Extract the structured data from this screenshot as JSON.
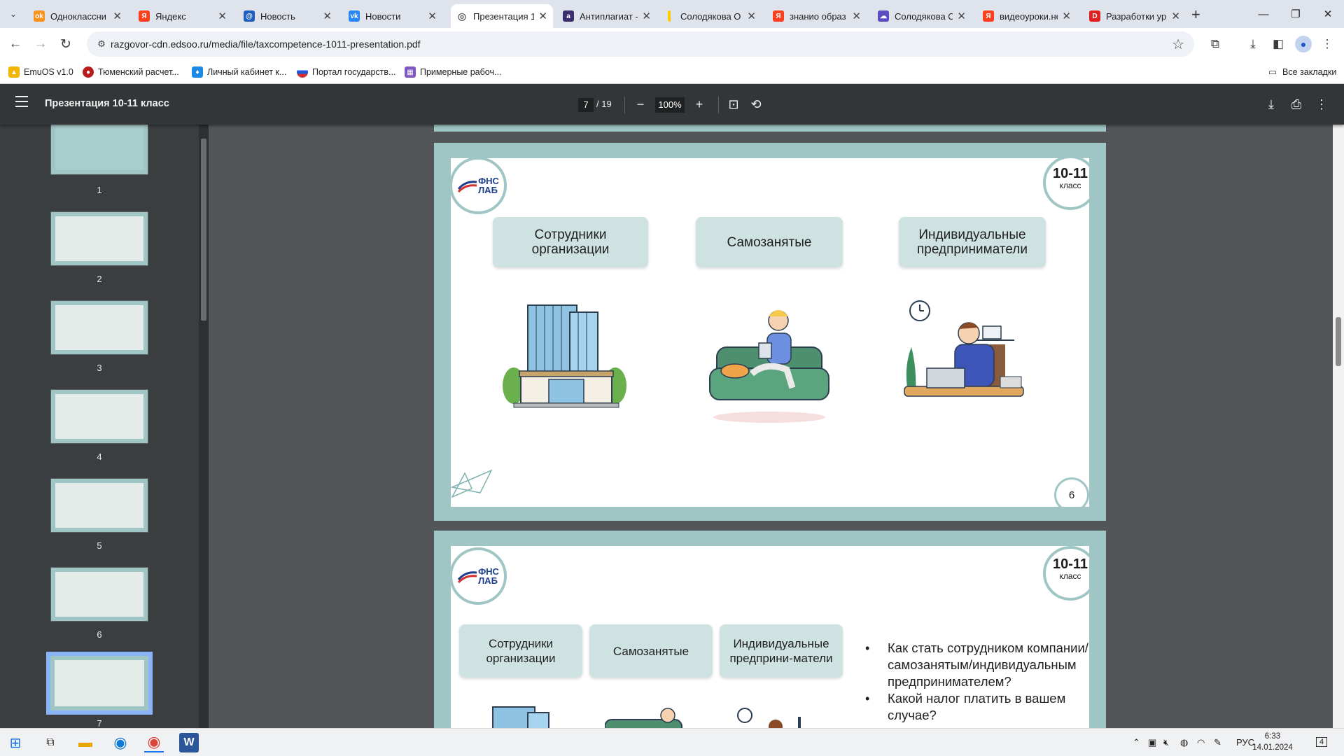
{
  "tabs": [
    {
      "title": "Одноклассни",
      "favicon": "odnoklassniki-icon",
      "color": "#f7931e",
      "glyph": "ok",
      "active": false
    },
    {
      "title": "Яндекс",
      "favicon": "yandex-icon",
      "color": "#fc3f1d",
      "glyph": "Я",
      "active": false
    },
    {
      "title": "Новость",
      "favicon": "news-icon",
      "color": "#1f5fbf",
      "glyph": "@",
      "active": false
    },
    {
      "title": "Новости",
      "favicon": "vk-icon",
      "color": "#2787f5",
      "glyph": "vk",
      "active": false
    },
    {
      "title": "Презентация 1",
      "favicon": "globe-icon",
      "color": "#5f6368",
      "glyph": "◎",
      "active": true
    },
    {
      "title": "Антиплагиат -",
      "favicon": "antiplagiat-icon",
      "color": "#3a2e6e",
      "glyph": "a",
      "active": false
    },
    {
      "title": "Солодякова О",
      "favicon": "yandex-disk-icon",
      "color": "#ffcc00",
      "glyph": "",
      "active": false
    },
    {
      "title": "знанио образ",
      "favicon": "yandex-icon",
      "color": "#fc3f1d",
      "glyph": "Я",
      "active": false
    },
    {
      "title": "Солодякова О",
      "favicon": "cloud-icon",
      "color": "#5b4cc4",
      "glyph": "☁",
      "active": false
    },
    {
      "title": "видеоуроки.не",
      "favicon": "yandex-icon",
      "color": "#fc3f1d",
      "glyph": "Я",
      "active": false
    },
    {
      "title": "Разработки ур",
      "favicon": "razrabotki-icon",
      "color": "#e02020",
      "glyph": "D",
      "active": false
    }
  ],
  "address": {
    "url": "razgovor-cdn.edsoo.ru/media/file/taxcompetence-1011-presentation.pdf"
  },
  "bookmarks": {
    "items": [
      {
        "label": "EmuOS v1.0",
        "color": "#f5b400",
        "icon": "emuos-icon"
      },
      {
        "label": "Тюменский расчет...",
        "color": "#b71c1c",
        "icon": "tyumen-icon"
      },
      {
        "label": "Личный кабинет к...",
        "color": "#1e88e5",
        "icon": "cabinet-icon"
      },
      {
        "label": "Портал государств...",
        "color": "#d32f2f",
        "icon": "gosuslugi-icon"
      },
      {
        "label": "Примерные рабоч...",
        "color": "#7e57c2",
        "icon": "programs-icon"
      }
    ],
    "all_label": "Все закладки"
  },
  "pdf": {
    "title": "Презентация 10-11 класс",
    "current_page": "7",
    "total_pages": "/ 19",
    "zoom": "100%"
  },
  "thumbnails": [
    "1",
    "2",
    "3",
    "4",
    "5",
    "6",
    "7"
  ],
  "slide6": {
    "logo": {
      "line1": "ФНС",
      "line2": "ЛАБ"
    },
    "grade": {
      "number": "10-11",
      "word": "класс"
    },
    "categories": [
      "Сотрудники организации",
      "Самозанятые",
      "Индивидуальные предприниматели"
    ],
    "page_number": "6"
  },
  "slide7": {
    "logo": {
      "line1": "ФНС",
      "line2": "ЛАБ"
    },
    "grade": {
      "number": "10-11",
      "word": "класс"
    },
    "categories": [
      "Сотрудники организации",
      "Самозанятые",
      "Индивидуальные предприни-матели"
    ],
    "bullets": [
      "Как стать сотрудником компании/самозанятым/индивидуальным предпринимателем?",
      "Какой налог платить в вашем случае?"
    ]
  },
  "taskbar": {
    "lang": "РУС",
    "time": "6:33",
    "date": "14.01.2024",
    "notifications": "4"
  },
  "colors": {
    "slide_frame": "#9fc6c5",
    "category_box": "#cfe2e2",
    "pdf_toolbar": "#323639",
    "accent": "#8ab4f8"
  }
}
